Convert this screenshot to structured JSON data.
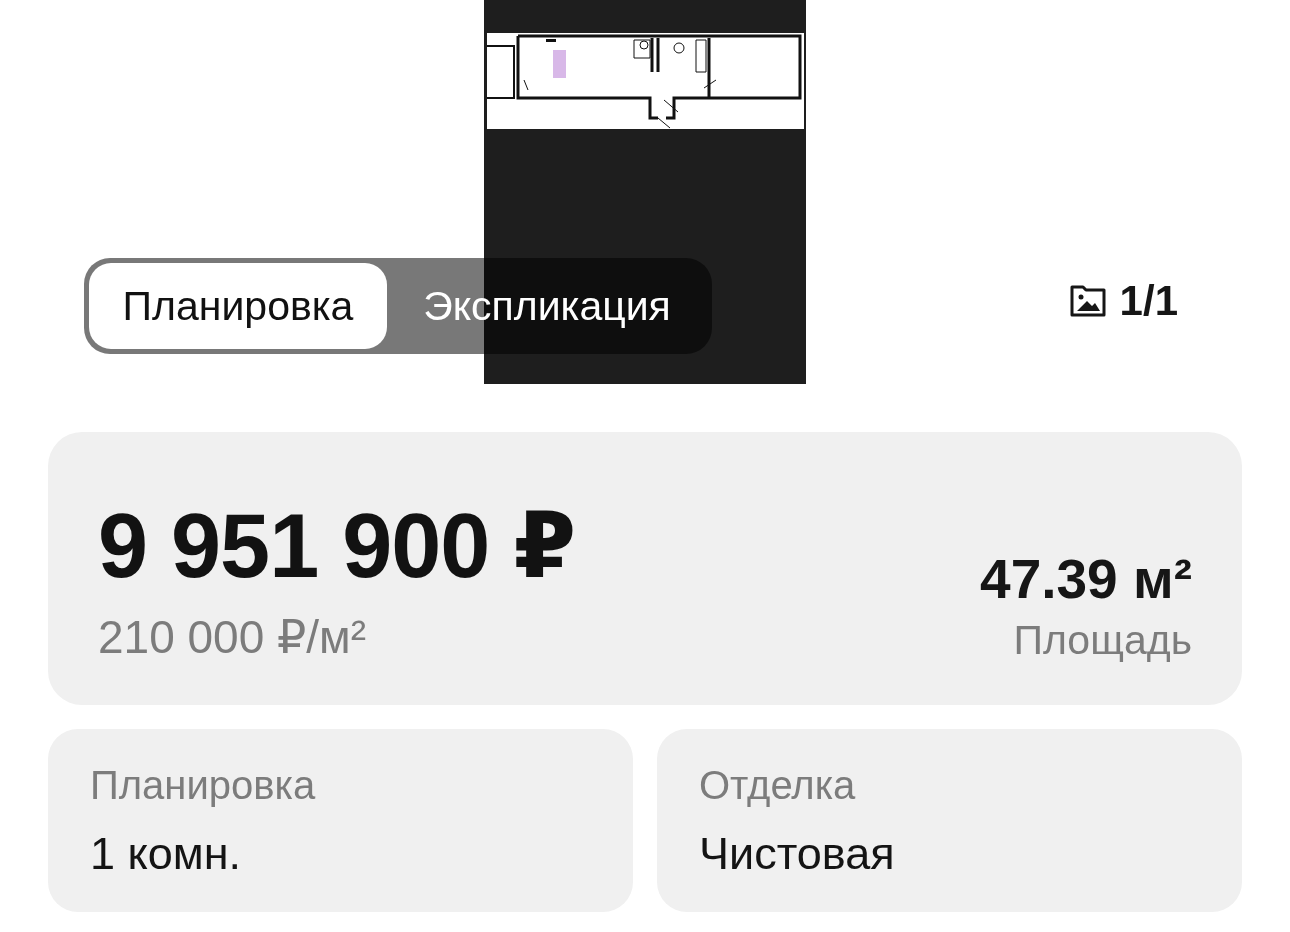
{
  "gallery": {
    "tabs": [
      {
        "label": "Планировка",
        "selected": true
      },
      {
        "label": "Экспликация",
        "selected": false
      }
    ],
    "counter": "1/1"
  },
  "price_card": {
    "price": "9 951 900 ₽",
    "price_per_m2": "210 000 ₽/м²",
    "area": "47.39 м²",
    "area_label": "Площадь"
  },
  "details": [
    {
      "label": "Планировка",
      "value": "1 комн."
    },
    {
      "label": "Отделка",
      "value": "Чистовая"
    }
  ]
}
